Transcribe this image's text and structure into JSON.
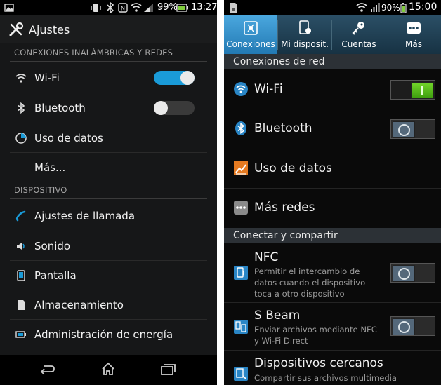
{
  "left": {
    "status": {
      "battery": "99%",
      "time": "13:27"
    },
    "title": "Ajustes",
    "sections": {
      "wireless": "CONEXIONES INALÁMBRICAS Y REDES",
      "device": "DISPOSITIVO"
    },
    "items": {
      "wifi": "Wi-Fi",
      "bluetooth": "Bluetooth",
      "data_usage": "Uso de datos",
      "more": "Más...",
      "call_settings": "Ajustes de llamada",
      "sound": "Sonido",
      "display": "Pantalla",
      "storage": "Almacenamiento",
      "power": "Administración de energía"
    },
    "toggles": {
      "wifi_on": true,
      "bluetooth_on": false
    },
    "accent": "#1a9bd8"
  },
  "right": {
    "status": {
      "battery": "90%",
      "time": "15:00"
    },
    "tabs": {
      "connections": "Conexiones",
      "my_device": "Mi disposit.",
      "accounts": "Cuentas",
      "more": "Más"
    },
    "sections": {
      "network": "Conexiones de red",
      "connect_share": "Conectar y compartir"
    },
    "items": {
      "wifi": "Wi-Fi",
      "bluetooth": "Bluetooth",
      "data_usage": "Uso de datos",
      "more_networks": "Más redes",
      "nfc": "NFC",
      "nfc_desc": "Permitir el intercambio de datos cuando el dispositivo toca a otro dispositivo",
      "sbeam": "S Beam",
      "sbeam_desc": "Enviar archivos mediante NFC y Wi-Fi Direct",
      "nearby": "Dispositivos cercanos",
      "nearby_desc": "Compartir sus archivos multimedia"
    },
    "toggles": {
      "wifi_on": true,
      "bluetooth_on": false,
      "nfc_on": false,
      "sbeam_on": false
    },
    "accent": "#2a86c6"
  }
}
